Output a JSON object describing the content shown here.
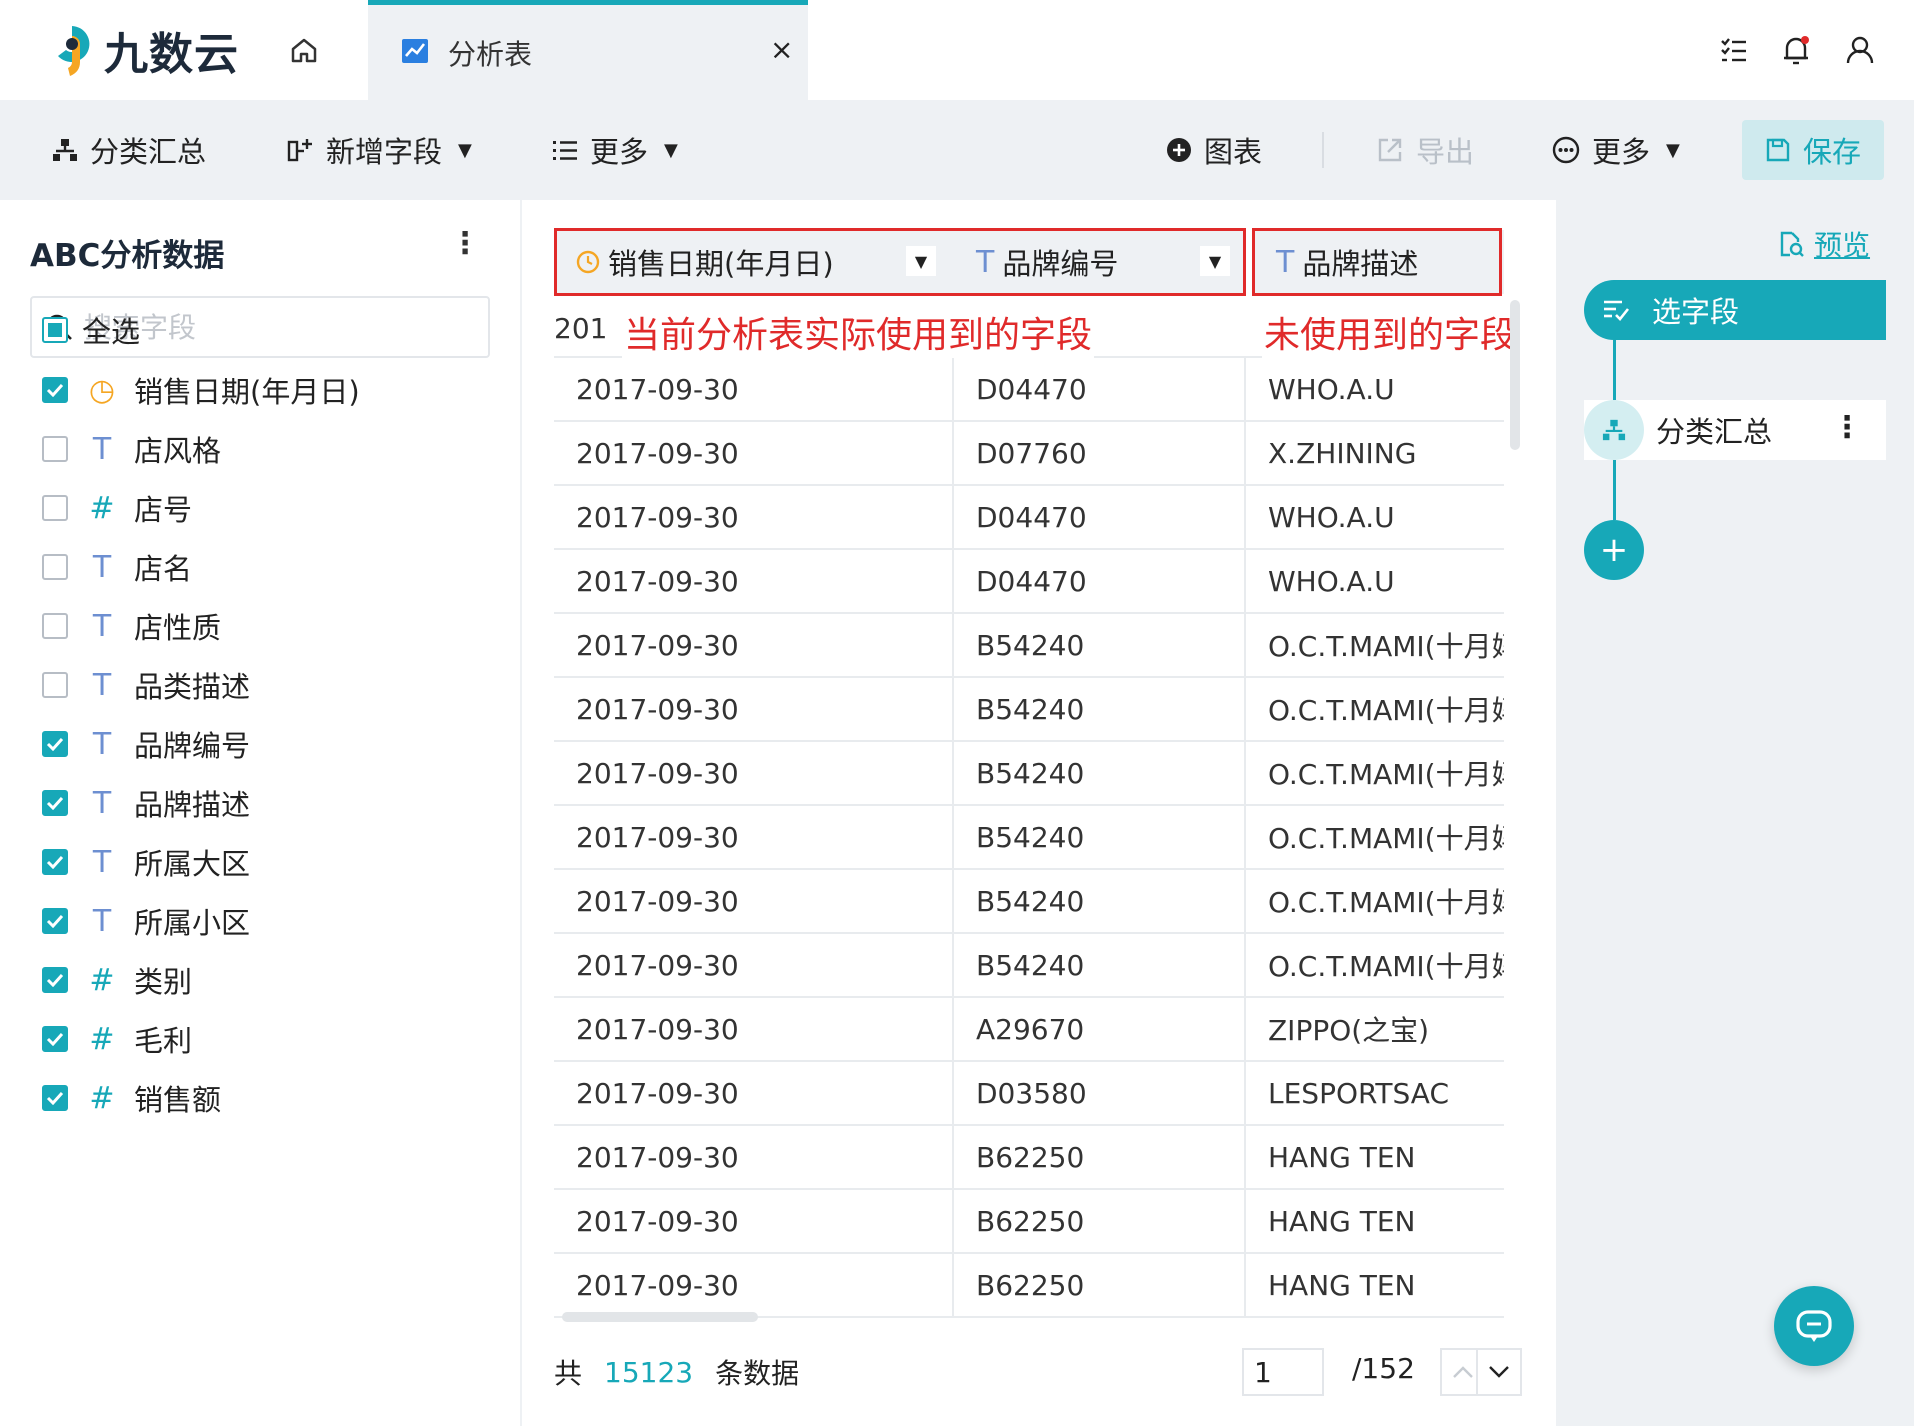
{
  "app": {
    "brand": "九数云",
    "accent": "#17a8b8",
    "highlight": "#e02a2a"
  },
  "tab": {
    "label": "分析表",
    "close": "×"
  },
  "toolbar": {
    "group_summary": "分类汇总",
    "add_field": "新增字段",
    "more_left": "更多",
    "chart": "图表",
    "export": "导出",
    "more_right": "更多",
    "save": "保存"
  },
  "left_panel": {
    "title": "ABC分析数据",
    "more": "⋮",
    "search_placeholder": "搜索字段",
    "select_all": {
      "label": "全选",
      "state": "partial"
    },
    "fields": [
      {
        "label": "销售日期(年月日)",
        "type": "date",
        "type_glyph": "◷",
        "checked": true
      },
      {
        "label": "店风格",
        "type": "text",
        "type_glyph": "T",
        "checked": false
      },
      {
        "label": "店号",
        "type": "number",
        "type_glyph": "#",
        "checked": false
      },
      {
        "label": "店名",
        "type": "text",
        "type_glyph": "T",
        "checked": false
      },
      {
        "label": "店性质",
        "type": "text",
        "type_glyph": "T",
        "checked": false
      },
      {
        "label": "品类描述",
        "type": "text",
        "type_glyph": "T",
        "checked": false
      },
      {
        "label": "品牌编号",
        "type": "text",
        "type_glyph": "T",
        "checked": true
      },
      {
        "label": "品牌描述",
        "type": "text",
        "type_glyph": "T",
        "checked": true
      },
      {
        "label": "所属大区",
        "type": "text",
        "type_glyph": "T",
        "checked": true
      },
      {
        "label": "所属小区",
        "type": "text",
        "type_glyph": "T",
        "checked": true
      },
      {
        "label": "类别",
        "type": "number",
        "type_glyph": "#",
        "checked": true
      },
      {
        "label": "毛利",
        "type": "number",
        "type_glyph": "#",
        "checked": true
      },
      {
        "label": "销售额",
        "type": "number",
        "type_glyph": "#",
        "checked": true
      }
    ]
  },
  "table": {
    "columns": [
      {
        "label": "销售日期(年月日)",
        "type": "date"
      },
      {
        "label": "品牌编号",
        "type": "text"
      },
      {
        "label": "品牌描述",
        "type": "text"
      }
    ],
    "first_row_partial": "201",
    "rows": [
      [
        "2017-09-30",
        "D04470",
        "WHO.A.U"
      ],
      [
        "2017-09-30",
        "D07760",
        "X.ZHINING"
      ],
      [
        "2017-09-30",
        "D04470",
        "WHO.A.U"
      ],
      [
        "2017-09-30",
        "D04470",
        "WHO.A.U"
      ],
      [
        "2017-09-30",
        "B54240",
        "O.C.T.MAMI(十月妈咪)"
      ],
      [
        "2017-09-30",
        "B54240",
        "O.C.T.MAMI(十月妈咪)"
      ],
      [
        "2017-09-30",
        "B54240",
        "O.C.T.MAMI(十月妈咪)"
      ],
      [
        "2017-09-30",
        "B54240",
        "O.C.T.MAMI(十月妈咪)"
      ],
      [
        "2017-09-30",
        "B54240",
        "O.C.T.MAMI(十月妈咪)"
      ],
      [
        "2017-09-30",
        "B54240",
        "O.C.T.MAMI(十月妈咪)"
      ],
      [
        "2017-09-30",
        "A29670",
        "ZIPPO(之宝)"
      ],
      [
        "2017-09-30",
        "D03580",
        "LESPORTSAC"
      ],
      [
        "2017-09-30",
        "B62250",
        "HANG TEN"
      ],
      [
        "2017-09-30",
        "B62250",
        "HANG TEN"
      ],
      [
        "2017-09-30",
        "B62250",
        "HANG TEN"
      ]
    ],
    "annotation_used": "当前分析表实际使用到的字段",
    "annotation_unused": "未使用到的字段"
  },
  "footer": {
    "prefix": "共",
    "count": "15123",
    "suffix": "条数据",
    "page": "1",
    "total_pages": "/152"
  },
  "right_panel": {
    "preview": "预览",
    "step_select": "选字段",
    "step_group": "分类汇总",
    "step_more": "⋮",
    "add": "+"
  }
}
